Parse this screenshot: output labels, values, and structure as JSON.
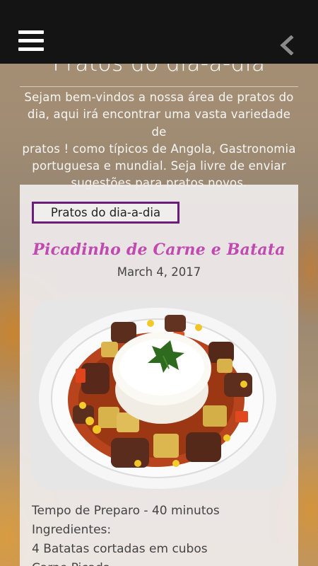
{
  "header": {
    "menu_icon": "hamburger-menu-icon",
    "back_icon": "chevron-left-icon"
  },
  "page": {
    "title": "Pratos do dia-a-dia",
    "intro_lines": [
      "Sejam bem-vindos a nossa área de pratos do",
      "dia, aqui irá encontrar uma vasta variedade de",
      "pratos ! como típicos de Angola, Gastronomia",
      "portuguesa e mundial. Seja livre de enviar",
      "sugestões para pratos novos."
    ]
  },
  "post": {
    "category": "Pratos do dia-a-dia",
    "title": "Picadinho de Carne e Batata",
    "date": "March 4, 2017",
    "image_alt": "plate-of-picadinho-image",
    "body_lines": [
      "Tempo de Preparo - 40 minutos",
      "Ingredientes:",
      "4 Batatas cortadas em cubos",
      "Carne Picada"
    ]
  },
  "colors": {
    "topbar": "#141414",
    "category_border": "#6a1e7c",
    "post_title": "#c04ab0"
  }
}
